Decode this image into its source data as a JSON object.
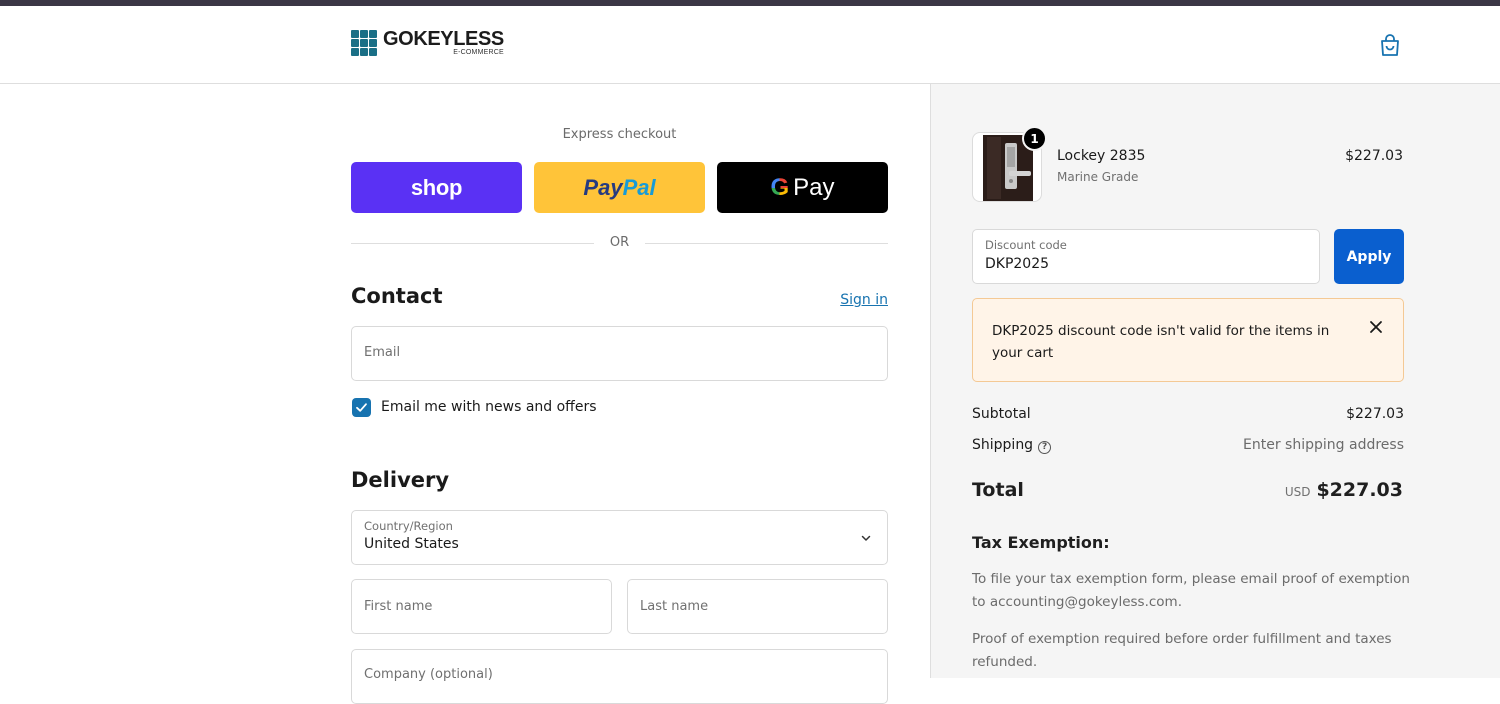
{
  "header": {
    "brand_name": "GOKEYLESS",
    "brand_sub": "E-COMMERCE",
    "cart_icon": "shopping-bag-icon"
  },
  "express": {
    "label": "Express checkout",
    "shop_label": "shop",
    "paypal_part1": "Pay",
    "paypal_part2": "Pal",
    "gpay_g": "G",
    "gpay_label": "Pay",
    "or_label": "OR"
  },
  "contact": {
    "title": "Contact",
    "signin_label": "Sign in",
    "email_placeholder": "Email",
    "newsletter_label": "Email me with news and offers",
    "newsletter_checked": true
  },
  "delivery": {
    "title": "Delivery",
    "country_label": "Country/Region",
    "country_value": "United States",
    "first_name_placeholder": "First name",
    "last_name_placeholder": "Last name",
    "company_placeholder": "Company (optional)"
  },
  "summary": {
    "item_quantity": "1",
    "item_name": "Lockey 2835",
    "item_variant": "Marine Grade",
    "item_price": "$227.03",
    "discount_label": "Discount code",
    "discount_value": "DKP2025",
    "apply_label": "Apply",
    "error_message": "DKP2025 discount code isn't valid for the items in your cart",
    "subtotal_label": "Subtotal",
    "subtotal_value": "$227.03",
    "shipping_label": "Shipping",
    "shipping_value": "Enter shipping address",
    "total_label": "Total",
    "total_currency": "USD",
    "total_value": "$227.03",
    "tax_title": "Tax Exemption:",
    "tax_p1": "To file your tax exemption form, please email proof of exemption to accounting@gokeyless.com.",
    "tax_p2": "Proof of exemption required before order fulfillment and taxes refunded."
  },
  "colors": {
    "shop_purple": "#5a31f4",
    "paypal_yellow": "#ffc439",
    "link_blue": "#1773b0",
    "apply_blue": "#0a5fcf",
    "error_bg": "#fff4e8"
  }
}
